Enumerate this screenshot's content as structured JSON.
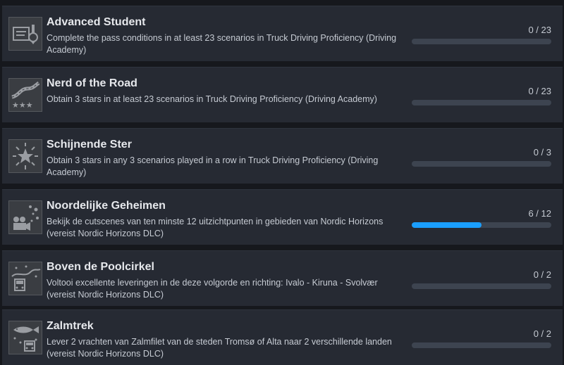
{
  "achievements": [
    {
      "title": "Advanced Student",
      "description": "Complete the pass conditions in at least 23 scenarios in Truck Driving Proficiency (Driving Academy)",
      "progress_text": "0 / 23",
      "progress": 0,
      "icon": "certificate-medal-icon"
    },
    {
      "title": "Nerd of the Road",
      "description": "Obtain 3 stars in at least 23 scenarios in Truck Driving Proficiency (Driving Academy)",
      "progress_text": "0 / 23",
      "progress": 0,
      "icon": "road-three-stars-icon"
    },
    {
      "title": "Schijnende Ster",
      "description": "Obtain 3 stars in any 3 scenarios played in a row in Truck Driving Proficiency (Driving Academy)",
      "progress_text": "0 / 3",
      "progress": 0,
      "icon": "shining-star-icon"
    },
    {
      "title": "Noordelijke Geheimen",
      "description": "Bekijk de cutscenes van ten minste 12 uitzichtpunten in gebieden van Nordic Horizons (vereist Nordic Horizons DLC)",
      "progress_text": "6 / 12",
      "progress": 0.5,
      "icon": "movie-camera-icon"
    },
    {
      "title": "Boven de Poolcirkel",
      "description": "Voltooi excellente leveringen in de deze volgorde en richting: Ivalo - Kiruna - Svolvær (vereist Nordic Horizons DLC)",
      "progress_text": "0 / 2",
      "progress": 0,
      "icon": "truck-aurora-icon"
    },
    {
      "title": "Zalmtrek",
      "description": "Lever 2 vrachten van Zalmfilet van de steden Tromsø of Alta naar 2 verschillende landen (vereist Nordic Horizons DLC)",
      "progress_text": "0 / 2",
      "progress": 0,
      "icon": "salmon-truck-icon"
    }
  ],
  "colors": {
    "progress_fill": "#1a9fff",
    "progress_track": "#3d4450",
    "row_background": "#262a33"
  }
}
